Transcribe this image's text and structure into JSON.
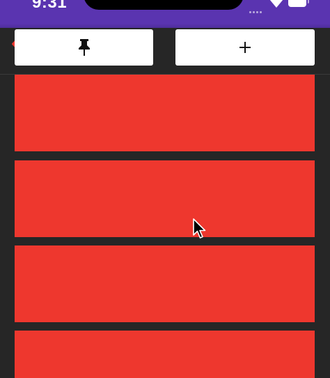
{
  "status_bar": {
    "time": "9:31",
    "icons": [
      "signal-icon",
      "wifi-icon",
      "battery-icon"
    ]
  },
  "toolbar": {
    "back_icon": "chevron-left-icon",
    "back_color": "#ee372e",
    "buttons": [
      {
        "icon": "pin-icon"
      },
      {
        "icon": "plus-icon"
      }
    ]
  },
  "list": {
    "item_color": "#ee372e",
    "item_count": 4
  },
  "colors": {
    "status_bar": "#5a34b0",
    "background": "#262626",
    "button": "#ffffff",
    "list_item": "#ee372e"
  },
  "pointer": "mouse-pointer-icon"
}
